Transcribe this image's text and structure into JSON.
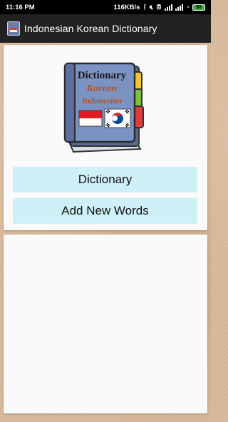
{
  "status_bar": {
    "time": "11:16 PM",
    "network_speed": "116KB/s",
    "battery_level": "88"
  },
  "toolbar": {
    "title": "Indonesian Korean Dictionary",
    "icon": "book-app-icon"
  },
  "logo": {
    "line1": "Dictionary",
    "line2": "Korean",
    "line3": "Indonesian"
  },
  "menu": {
    "dictionary_label": "Dictionary",
    "add_words_label": "Add New Words"
  },
  "colors": {
    "toolbar_bg": "#212121",
    "button_bg": "#cff0f7",
    "panel_bg": "#fafafa",
    "book_cover": "#7b93c2",
    "tab_yellow": "#f4c430",
    "tab_green": "#7cc242",
    "tab_red": "#e23b3b"
  }
}
